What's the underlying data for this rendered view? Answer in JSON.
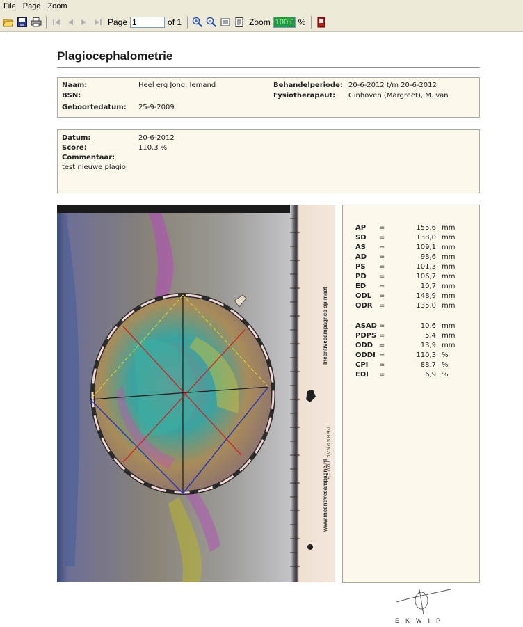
{
  "menu": {
    "items": [
      "File",
      "Page",
      "Zoom"
    ]
  },
  "toolbar": {
    "page_label": "Page",
    "page_value": "1",
    "of_label": "of 1",
    "zoom_label": "Zoom",
    "zoom_value": "100.0",
    "percent": "%"
  },
  "document": {
    "title": "Plagiocephalometrie",
    "patient": {
      "naam_label": "Naam:",
      "naam": "Heel erg Jong, Iemand",
      "bsn_label": "BSN:",
      "geboortedatum_label": "Geboortedatum:",
      "geboortedatum": "25-9-2009",
      "behandelperiode_label": "Behandelperiode:",
      "behandelperiode": "20-6-2012 t/m 20-6-2012",
      "fysiotherapeut_label": "Fysiotherapeut:",
      "fysiotherapeut": "Ginhoven (Margreet), M. van"
    },
    "session": {
      "datum_label": "Datum:",
      "datum": "20-6-2012",
      "score_label": "Score:",
      "score": "110,3 %",
      "commentaar_label": "Commentaar:",
      "commentaar": "test nieuwe plagio"
    },
    "ruler": {
      "brand": "Incentivecampagnes op maat",
      "tagline": "PERSONAL TOUCH",
      "url": "www.incentivecampagne.nl"
    },
    "measurements": [
      {
        "code": "AP",
        "eq": "=",
        "value": "155,6",
        "unit": "mm"
      },
      {
        "code": "SD",
        "eq": "=",
        "value": "138,0",
        "unit": "mm"
      },
      {
        "code": "AS",
        "eq": "=",
        "value": "109,1",
        "unit": "mm"
      },
      {
        "code": "AD",
        "eq": "=",
        "value": "98,6",
        "unit": "mm"
      },
      {
        "code": "PS",
        "eq": "=",
        "value": "101,3",
        "unit": "mm"
      },
      {
        "code": "PD",
        "eq": "=",
        "value": "106,7",
        "unit": "mm"
      },
      {
        "code": "ED",
        "eq": "=",
        "value": "10,7",
        "unit": "mm"
      },
      {
        "code": "ODL",
        "eq": "=",
        "value": "148,9",
        "unit": "mm"
      },
      {
        "code": "ODR",
        "eq": "=",
        "value": "135,0",
        "unit": "mm"
      },
      {
        "code": "ASAD",
        "eq": "=",
        "value": "10,6",
        "unit": "mm"
      },
      {
        "code": "PDPS",
        "eq": "=",
        "value": "5,4",
        "unit": "mm"
      },
      {
        "code": "ODD",
        "eq": "=",
        "value": "13,9",
        "unit": "mm"
      },
      {
        "code": "ODDI",
        "eq": "=",
        "value": "110,3",
        "unit": "%"
      },
      {
        "code": "CPI",
        "eq": "=",
        "value": "88,7",
        "unit": "%"
      },
      {
        "code": "EDI",
        "eq": "=",
        "value": "6,9",
        "unit": "%"
      }
    ],
    "logo_text": "EKWIP"
  },
  "colors": {
    "chrome": "#ece9d8",
    "box_bg": "#fcf8ec",
    "zoom_field": "#1f9c3c",
    "measure_red": "#cc2222",
    "measure_blue": "#2233bb",
    "measure_yellow": "#e0e020"
  }
}
